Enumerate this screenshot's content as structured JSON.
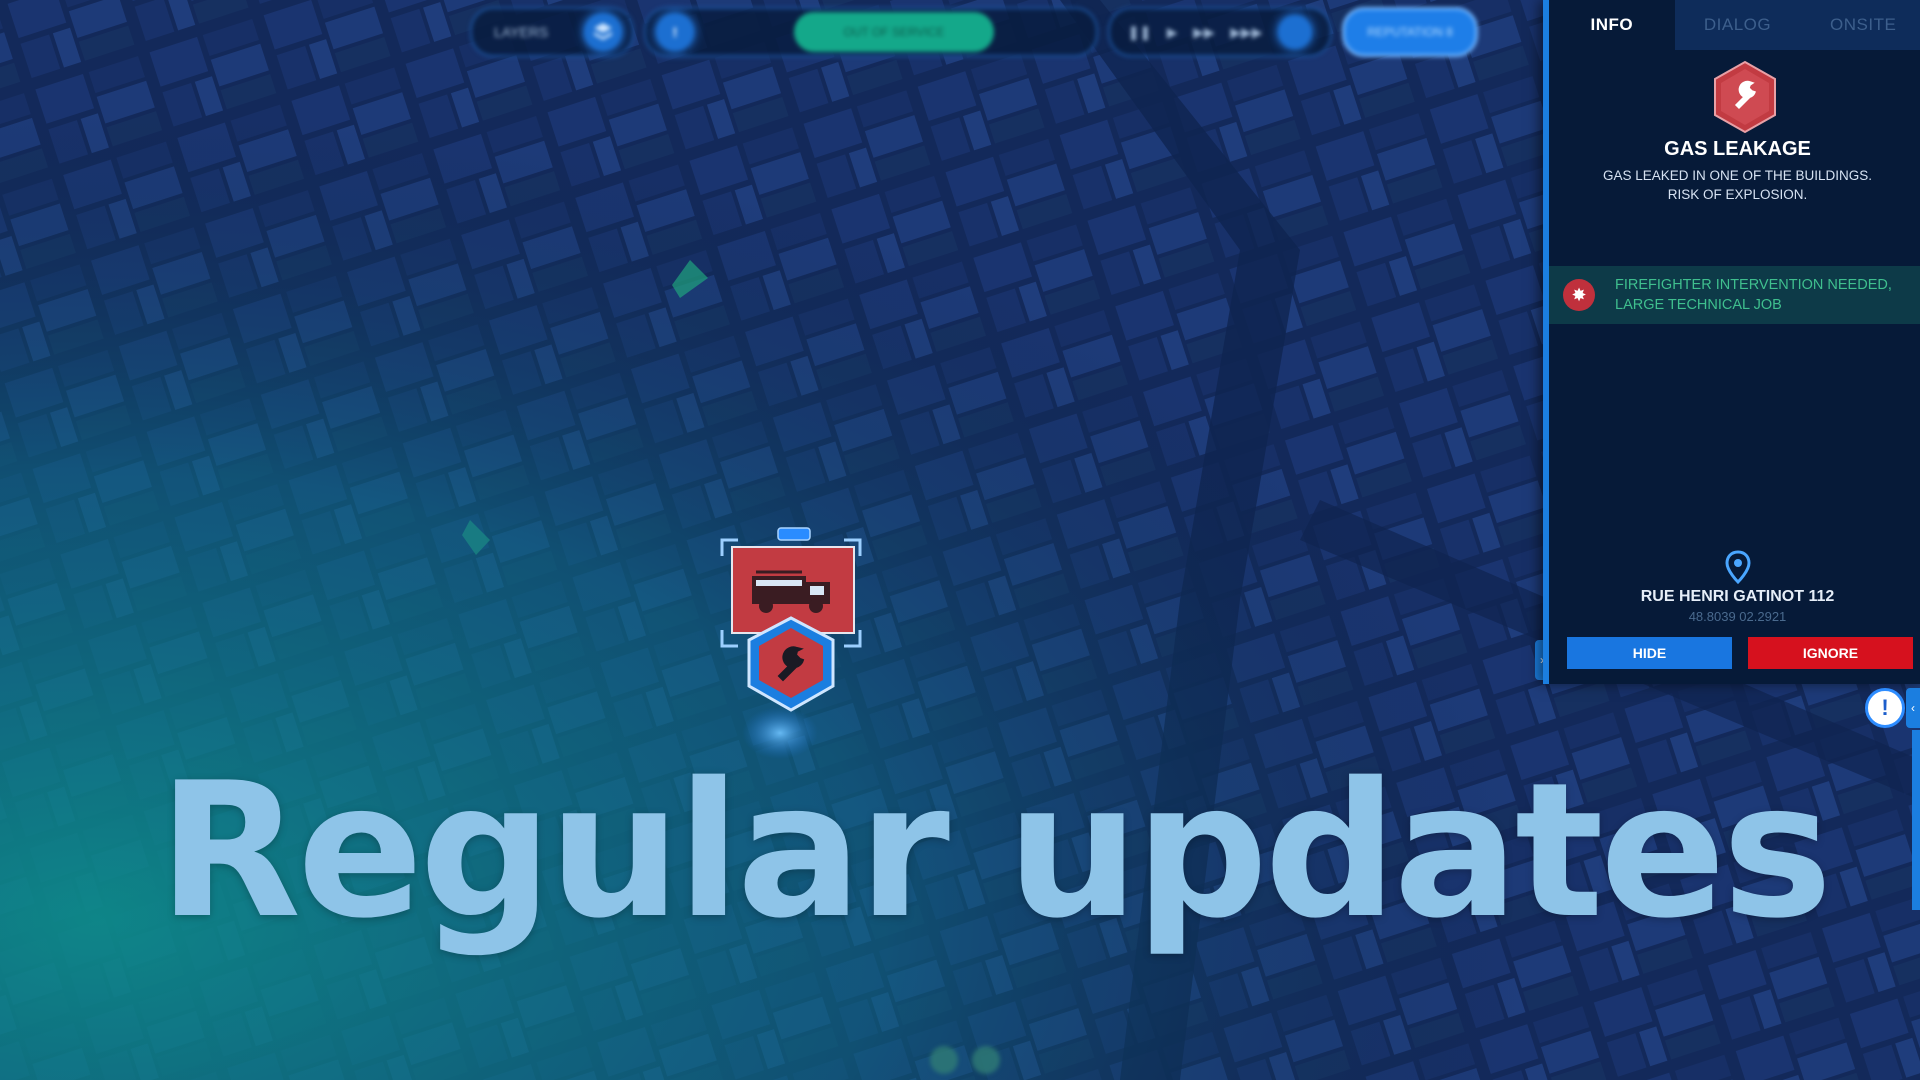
{
  "topbar": {
    "layers_label": "LAYERS",
    "layers_icon": "layers-icon",
    "status_text": "OUT OF SERVICE",
    "reputation_label": "REPUTATION 8",
    "speed_icons": [
      "pause-icon",
      "play-icon",
      "fast-forward-icon",
      "faster-icon"
    ]
  },
  "panel": {
    "tabs": [
      {
        "label": "INFO",
        "active": true
      },
      {
        "label": "DIALOG",
        "active": false
      },
      {
        "label": "ONSITE",
        "active": false
      }
    ],
    "incident": {
      "icon": "wrench-icon",
      "title": "GAS LEAKAGE",
      "description": "GAS LEAKED IN ONE OF THE BUILDINGS. RISK OF EXPLOSION."
    },
    "requirement": {
      "icon": "firefighter-icon",
      "text": "FIREFIGHTER INTERVENTION NEEDED, LARGE TECHNICAL JOB"
    },
    "location": {
      "icon": "map-pin-icon",
      "address": "RUE HENRI GATINOT 112",
      "coords": "48.8039 02.2921"
    },
    "buttons": {
      "hide": "HIDE",
      "ignore": "IGNORE"
    }
  },
  "map_marker": {
    "vehicle_icon": "fire-truck-icon",
    "incident_icon": "wrench-icon"
  },
  "alert_icon": "exclamation-icon",
  "headline": "Regular updates",
  "colors": {
    "panel_bg": "#061a38",
    "accent_blue": "#1b7ee0",
    "danger_red": "#d6111e",
    "incident_red": "#c23b42",
    "requirement_green": "#3fbf8e",
    "headline_blue": "#8ec4e8",
    "teal": "#0e8a8a"
  }
}
